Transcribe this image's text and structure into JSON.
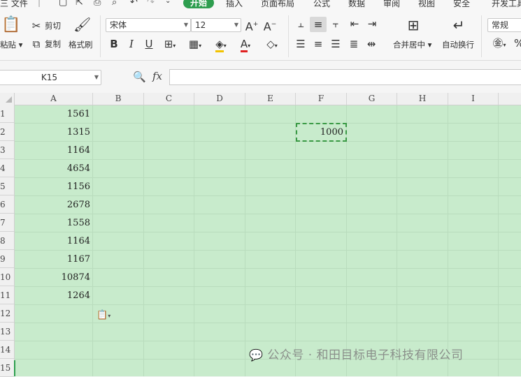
{
  "menu": {
    "file": "三 文件",
    "tabs": [
      "开始",
      "插入",
      "页面布局",
      "公式",
      "数据",
      "审阅",
      "视图",
      "安全",
      "开发工具"
    ]
  },
  "ribbon": {
    "paste": "粘贴",
    "cut": "剪切",
    "copy": "复制",
    "format_painter": "格式刷",
    "font_name": "宋体",
    "font_size": "12",
    "merge_center": "合并居中",
    "wrap_text": "自动换行",
    "number_format": "常规"
  },
  "formula_bar": {
    "name_box": "K15",
    "fx_label": "fx",
    "formula": ""
  },
  "grid": {
    "columns": [
      "A",
      "B",
      "C",
      "D",
      "E",
      "F",
      "G",
      "H",
      "I"
    ],
    "rows": [
      "1",
      "2",
      "3",
      "4",
      "5",
      "6",
      "7",
      "8",
      "9",
      "10",
      "11",
      "12",
      "13",
      "14",
      "15"
    ],
    "column_a_values": [
      "1561",
      "1315",
      "1164",
      "4654",
      "1156",
      "2678",
      "1558",
      "1164",
      "1167",
      "10874",
      "1264"
    ],
    "f2_value": "1000",
    "selected_cell": "F2",
    "cell_color": "#c8ebcc",
    "selection_color": "#3a9a45"
  },
  "watermark": "公众号 · 和田目标电子科技有限公司"
}
